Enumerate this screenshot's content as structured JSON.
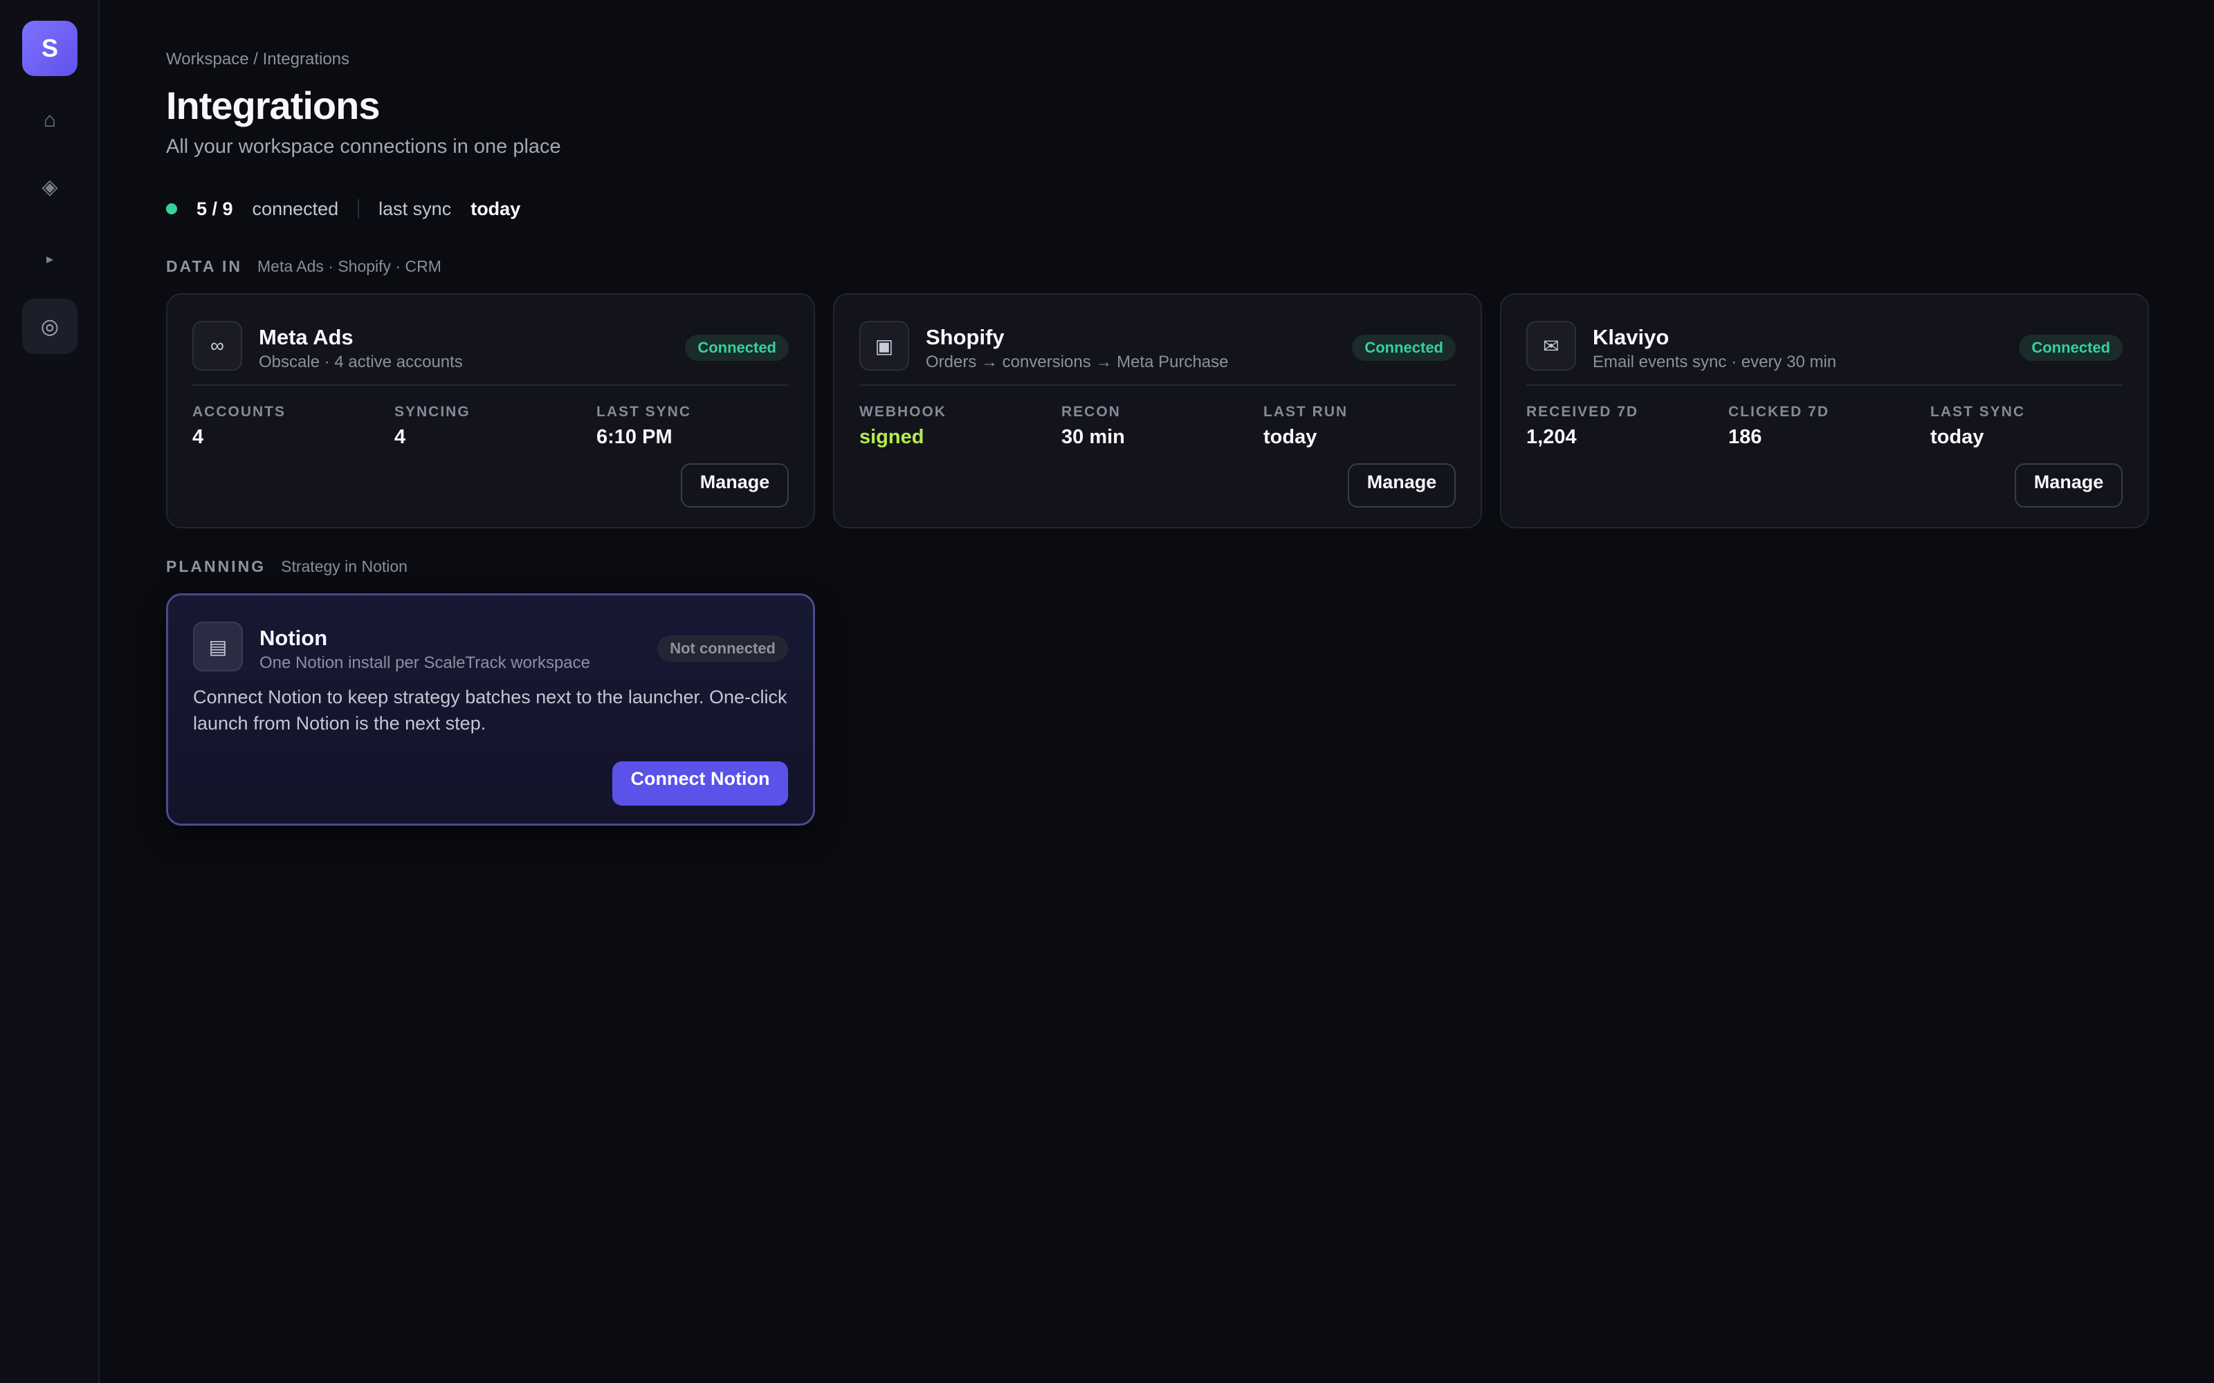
{
  "sidebar": {
    "logo_letter": "S",
    "items": [
      {
        "name": "home",
        "icon": "⌂"
      },
      {
        "name": "tag",
        "icon": "◈"
      },
      {
        "name": "play",
        "icon": "▸"
      },
      {
        "name": "integrations",
        "icon": "◎",
        "active": true
      }
    ]
  },
  "header": {
    "breadcrumb": "Workspace / Integrations",
    "title": "Integrations",
    "subtitle": "All your workspace connections in one place"
  },
  "status": {
    "count": "5 / 9",
    "count_label": "connected",
    "sync_label": "last sync",
    "sync_value": "today",
    "dot_color": "#34d399"
  },
  "sections": {
    "data_in": {
      "title": "DATA IN",
      "desc": "Meta Ads · Shopify · CRM"
    },
    "planning": {
      "title": "PLANNING",
      "desc": "Strategy in Notion"
    }
  },
  "cards": [
    {
      "name": "Meta Ads",
      "icon": "∞",
      "subtitle": "Obscale · 4 active accounts",
      "badge": "Connected",
      "stats": [
        {
          "label": "ACCOUNTS",
          "value": "4"
        },
        {
          "label": "SYNCING",
          "value": "4"
        },
        {
          "label": "LAST SYNC",
          "value": "6:10 PM"
        }
      ],
      "action": "Manage"
    },
    {
      "name": "Shopify",
      "icon": "▣",
      "subtitle": "Orders → conversions → Meta Purchase",
      "badge": "Connected",
      "stats": [
        {
          "label": "WEBHOOK",
          "value": "signed"
        },
        {
          "label": "RECON",
          "value": "30 min"
        },
        {
          "label": "LAST RUN",
          "value": "today"
        }
      ],
      "action": "Manage"
    },
    {
      "name": "Klaviyo",
      "icon": "✉",
      "subtitle": "Email events sync · every 30 min",
      "badge": "Connected",
      "stats": [
        {
          "label": "RECEIVED 7D",
          "value": "1,204"
        },
        {
          "label": "CLICKED 7D",
          "value": "186"
        },
        {
          "label": "LAST SYNC",
          "value": "today"
        }
      ],
      "action": "Manage"
    }
  ],
  "notion": {
    "name": "Notion",
    "icon": "▤",
    "subtitle": "One Notion install per ScaleTrack workspace",
    "badge": "Not connected",
    "body": "Connect Notion to keep strategy batches next to the launcher. One-click launch from Notion is the next step.",
    "action": "Connect Notion"
  },
  "colors": {
    "accent": "#5b52ea",
    "connected": "#34d399",
    "signed": "#b7ea4e",
    "background": "#0b0c11"
  }
}
